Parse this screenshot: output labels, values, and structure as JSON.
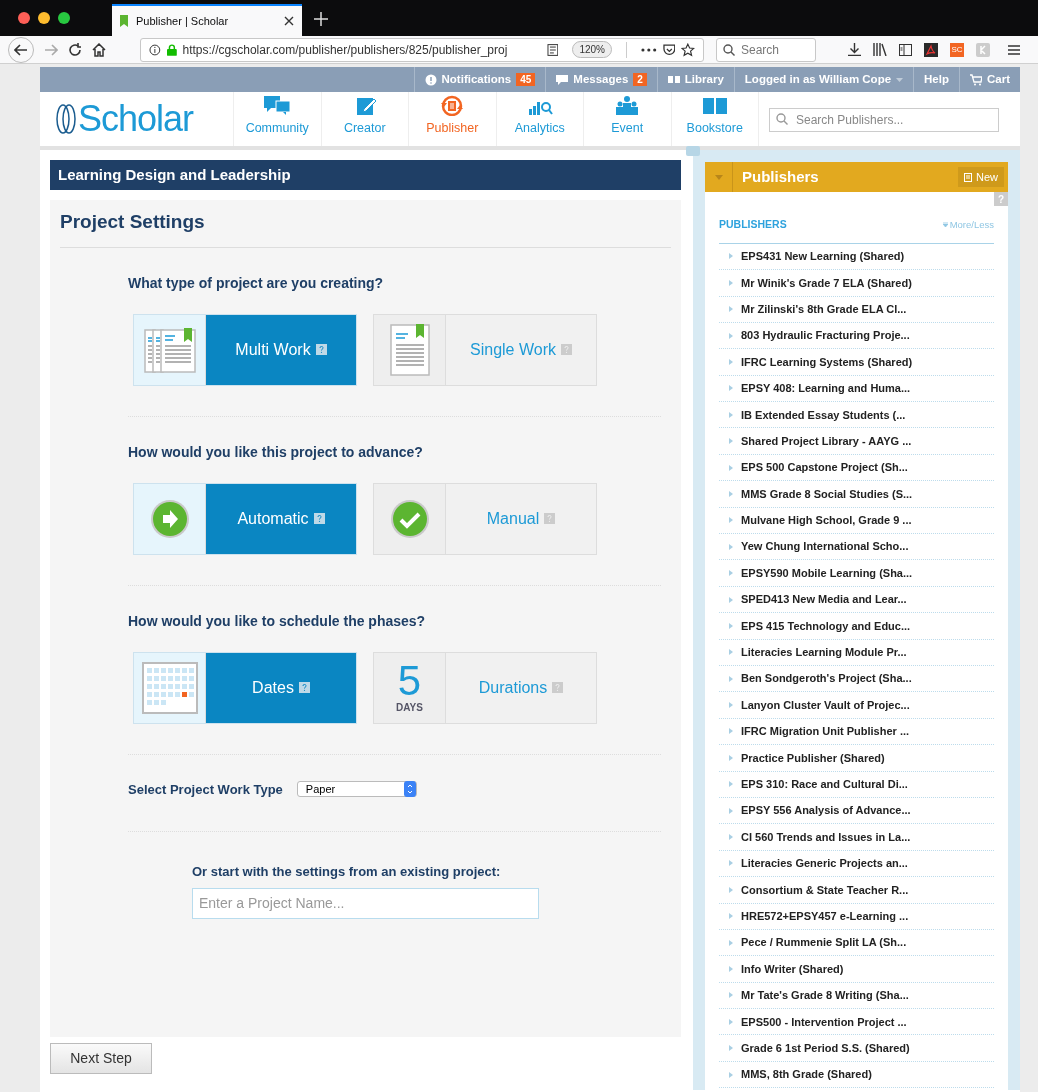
{
  "browser": {
    "tab_title": "Publisher | Scholar",
    "url": "https://cgscholar.com/publisher/publishers/825/publisher_proj",
    "zoom": "120%",
    "search_placeholder": "Search",
    "sc_badge": "SC"
  },
  "top_bar": [
    {
      "kind": "notifications",
      "label": "Notifications",
      "count": "45"
    },
    {
      "kind": "messages",
      "label": "Messages",
      "count": "2"
    },
    {
      "kind": "library",
      "label": "Library"
    },
    {
      "kind": "user",
      "label": "Logged in as William Cope"
    },
    {
      "kind": "plain",
      "label": "Help"
    },
    {
      "kind": "cart",
      "label": "Cart"
    }
  ],
  "logo": "Scholar",
  "nav": [
    {
      "kind": "community",
      "label": "Community",
      "selected": false
    },
    {
      "kind": "creator",
      "label": "Creator",
      "selected": false
    },
    {
      "kind": "publisher",
      "label": "Publisher",
      "selected": true
    },
    {
      "kind": "analytics",
      "label": "Analytics",
      "selected": false
    },
    {
      "kind": "event",
      "label": "Event",
      "selected": false
    },
    {
      "kind": "bookstore",
      "label": "Bookstore",
      "selected": false
    }
  ],
  "search": {
    "placeholder": "Search Publishers..."
  },
  "banner": "Learning Design and Leadership",
  "panel_title": "Project Settings",
  "questions": [
    {
      "text": "What type of project are you creating?",
      "options": [
        {
          "kind": "multi",
          "label": "Multi Work",
          "selected": true
        },
        {
          "kind": "single",
          "label": "Single Work",
          "selected": false
        }
      ]
    },
    {
      "text": "How would you like this project to advance?",
      "options": [
        {
          "kind": "arrow",
          "label": "Automatic",
          "selected": true
        },
        {
          "kind": "check",
          "label": "Manual",
          "selected": false
        }
      ]
    },
    {
      "text": "How would you like to schedule the phases?",
      "options": [
        {
          "kind": "calendar",
          "label": "Dates",
          "selected": true
        },
        {
          "kind": "days",
          "label": "Durations",
          "selected": false,
          "number": "5",
          "unit": "DAYS"
        }
      ]
    }
  ],
  "work_type": {
    "label": "Select Project Work Type",
    "value": "Paper"
  },
  "existing": {
    "label": "Or start with the settings from an existing project:",
    "placeholder": "Enter a Project Name..."
  },
  "next_button": "Next Step",
  "sidebar": {
    "title": "Publishers",
    "new_button": "New",
    "help": "?",
    "section": "PUBLISHERS",
    "more_less": "More/Less",
    "items": [
      "EPS431 New Learning (Shared)",
      "Mr Winik's Grade 7 ELA (Shared)",
      "Mr Zilinski's 8th Grade ELA Cl...",
      "803 Hydraulic Fracturing Proje...",
      "IFRC Learning Systems (Shared)",
      "EPSY 408: Learning and Huma...",
      "IB Extended Essay Students (...",
      "Shared Project Library - AAYG ...",
      "EPS 500 Capstone Project (Sh...",
      "MMS Grade 8 Social Studies (S...",
      "Mulvane High School, Grade 9 ...",
      "Yew Chung International Scho...",
      "EPSY590 Mobile Learning (Sha...",
      "SPED413 New Media and Lear...",
      "EPS 415 Technology and Educ...",
      "Literacies Learning Module Pr...",
      "Ben Sondgeroth's Project (Sha...",
      "Lanyon Cluster Vault of Projec...",
      "IFRC Migration Unit Publisher ...",
      "Practice Publisher (Shared)",
      "EPS 310: Race and Cultural Di...",
      "EPSY 556 Analysis of Advance...",
      "CI 560 Trends and Issues in La...",
      "Literacies Generic Projects an...",
      "Consortium & State Teacher R...",
      "HRE572+EPSY457 e-Learning ...",
      "Pece / Rummenie Split LA (Sh...",
      "Info Writer (Shared)",
      "Mr Tate's Grade 8 Writing (Sha...",
      "EPS500 - Intervention Project ...",
      "Grade 6 1st Period S.S. (Shared)",
      "MMS, 8th Grade (Shared)"
    ]
  }
}
